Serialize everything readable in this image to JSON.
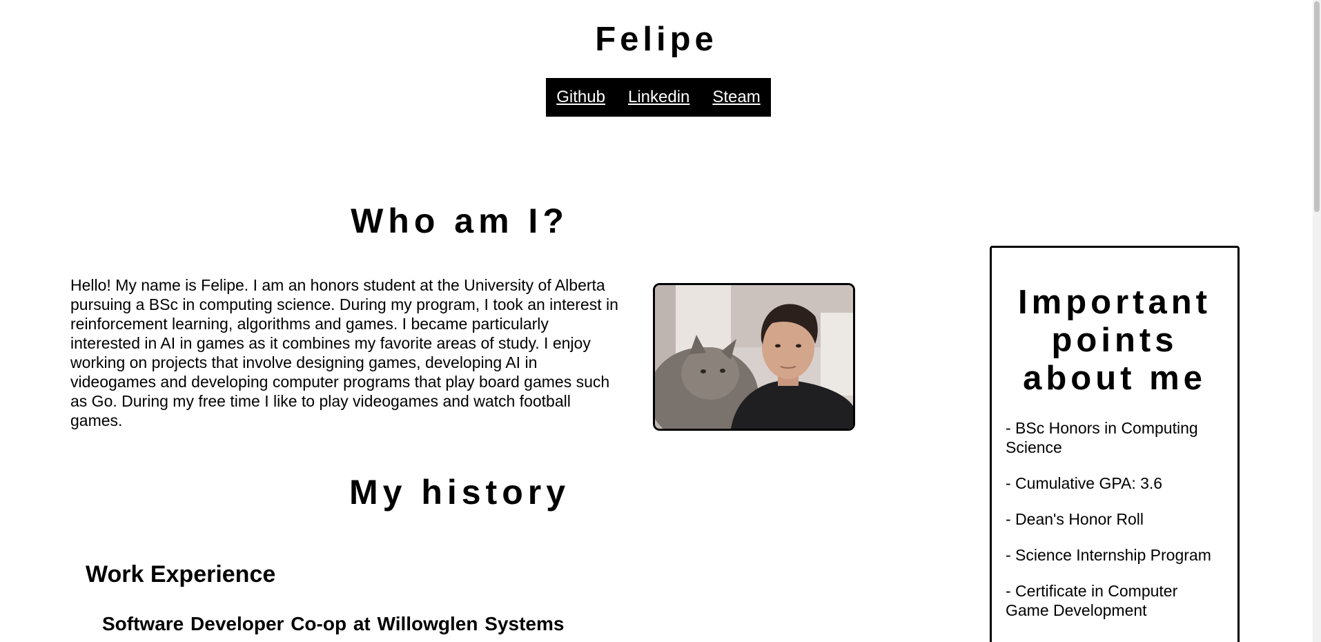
{
  "header": {
    "title": "Felipe"
  },
  "nav": {
    "links": [
      "Github",
      "Linkedin",
      "Steam"
    ]
  },
  "about": {
    "heading": "Who am I?",
    "bio": "Hello! My name is Felipe. I am an honors student at the University of Alberta pursuing a BSc in computing science. During my program, I took an interest in reinforcement learning, algorithms and games. I became particularly interested in AI in games as it combines my favorite areas of study. I enjoy working on projects that involve designing games, developing AI in videogames and developing computer programs that play board games such as Go. During my free time I like to play videogames and watch football games."
  },
  "history": {
    "heading": "My history",
    "work_heading": "Work Experience",
    "jobs": [
      "Software Developer Co-op at Willowglen Systems"
    ]
  },
  "sidebar": {
    "title": "Important points about me",
    "points": [
      "- BSc Honors in Computing Science",
      "- Cumulative GPA: 3.6",
      "- Dean's Honor Roll",
      "- Science Internship Program",
      "- Certificate in Computer Game Development"
    ]
  }
}
